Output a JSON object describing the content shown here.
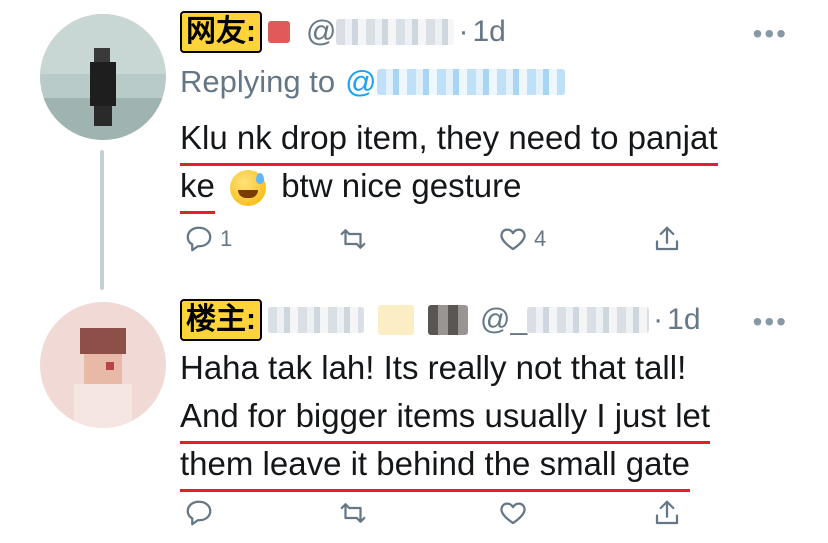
{
  "tweet1": {
    "tag": "网友:",
    "handle": "@",
    "dot": "·",
    "time": "1d",
    "more": "•••",
    "replying_prefix": "Replying to",
    "replying_handle": "@",
    "text_line1": "Klu nk drop item, they need to panjat",
    "text_line2a": "ke",
    "text_line2b": "btw nice gesture",
    "emoji": "sweat-smile-emoji",
    "reply_count": "1",
    "like_count": "4"
  },
  "tweet2": {
    "tag": "楼主:",
    "handle": "@_",
    "dot": "·",
    "time": "1d",
    "more": "•••",
    "text_line1": "Haha tak lah! Its really not that tall!",
    "text_line2": "And for bigger items usually I just let",
    "text_line3": "them leave it behind the small gate"
  },
  "colors": {
    "underline": "#e0202a",
    "tag_bg": "#ffd43b",
    "link": "#1da1f2",
    "muted": "#657786"
  }
}
